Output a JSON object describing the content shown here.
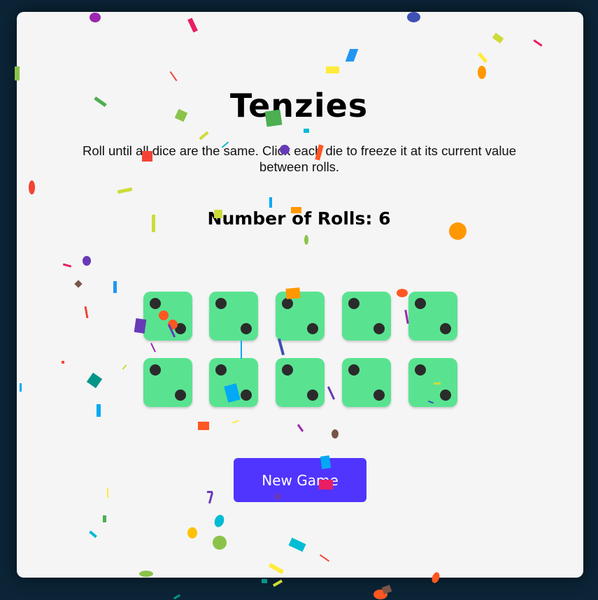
{
  "game": {
    "title": "Tenzies",
    "instructions": "Roll until all dice are the same. Click each die to freeze it at its current value between rolls.",
    "rolls_label": "Number of Rolls: 6",
    "rolls": 6,
    "button_label": "New Game"
  },
  "dice": [
    {
      "value": 2,
      "held": true
    },
    {
      "value": 2,
      "held": true
    },
    {
      "value": 2,
      "held": true
    },
    {
      "value": 2,
      "held": true
    },
    {
      "value": 2,
      "held": true
    },
    {
      "value": 2,
      "held": true
    },
    {
      "value": 2,
      "held": true
    },
    {
      "value": 2,
      "held": true
    },
    {
      "value": 2,
      "held": true
    },
    {
      "value": 2,
      "held": true
    }
  ],
  "colors": {
    "page_background": "#0b2436",
    "card_background": "#f5f5f5",
    "die_held": "#59e391",
    "pip": "#2b2b2b",
    "button": "#5035ff",
    "button_text": "#ffffff"
  },
  "effects": {
    "confetti": true,
    "confetti_colors": [
      "#9c27b0",
      "#e91e63",
      "#8bc34a",
      "#cddc39",
      "#ffeb3b",
      "#ff9800",
      "#f44336",
      "#03a9f4",
      "#2196f3",
      "#4caf50",
      "#673ab7",
      "#00bcd4",
      "#795548",
      "#ff5722",
      "#009688",
      "#3f51b5"
    ]
  }
}
